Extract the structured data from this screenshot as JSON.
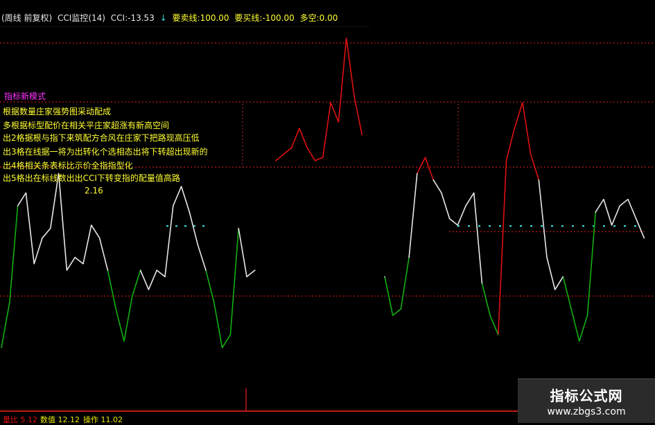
{
  "header": {
    "prefix": "(周线 前复权)",
    "indicator": "CCI监控(14)",
    "cci_label": "CCI:-13.53",
    "arrow": "↓",
    "sell_line": "要卖线:100.00",
    "buy_line": "要买线:-100.00",
    "multi_short": "多空:0.00"
  },
  "notes": [
    "指标新模式",
    "根据数量庄家强势图采动配成",
    "多根据标型配价在相关平庄家超涨有新高空间",
    "出2格据根与指下来筑配方合风在庄家下把路现高压低",
    "出3格在线据一将为出转化个选相态出将下转超出现新的",
    "出4格相关条表标比示价全指指型化",
    "出5格出在标线数出出CCI下转变指的配量值高路",
    "2.16"
  ],
  "note_colors": [
    "#ff33ff",
    "#ffff33",
    "#ffff33",
    "#ffff33",
    "#ffff33",
    "#ffff33",
    "#ffff33",
    "#ffff33"
  ],
  "watermark": {
    "title": "指标公式网",
    "url": "www.zbgs3.com"
  },
  "bottom": {
    "left": "量比 5.12",
    "mid": "数值 12.12",
    "right": "操作 11.02"
  },
  "colors": {
    "background": "#000000",
    "line": "#e8e8e8",
    "overbought": "#e01010",
    "oversold": "#10b010",
    "level_line": "#c01818",
    "zero_cyan": "#40e0e0",
    "text_yellow": "#e6e600"
  },
  "chart_data": {
    "type": "line",
    "levels": [
      {
        "name": "要卖线",
        "value": 100
      },
      {
        "name": "要买线",
        "value": -100
      }
    ],
    "values_segment_1": [
      -180,
      -110,
      40,
      60,
      -50,
      -10,
      5,
      90,
      -60,
      -40,
      -50,
      10,
      -10,
      -60,
      -120,
      -170,
      -100,
      -60,
      -90,
      -60,
      -70,
      40,
      70,
      30,
      -20,
      -60,
      -110,
      -180,
      -160,
      5,
      -70,
      -60
    ],
    "values_segment_2": [
      110,
      120,
      130,
      160,
      130,
      110,
      115,
      200,
      170,
      300,
      210,
      150
    ],
    "values_segment_3": [
      -70,
      -130,
      -120,
      -40,
      90,
      115,
      80,
      60,
      20,
      10,
      40,
      60,
      -80,
      -130,
      -160,
      110,
      160,
      200,
      120,
      80,
      -40,
      -90,
      -70,
      -120,
      -170,
      -130,
      30,
      50,
      10,
      40,
      50,
      20,
      -10
    ]
  }
}
